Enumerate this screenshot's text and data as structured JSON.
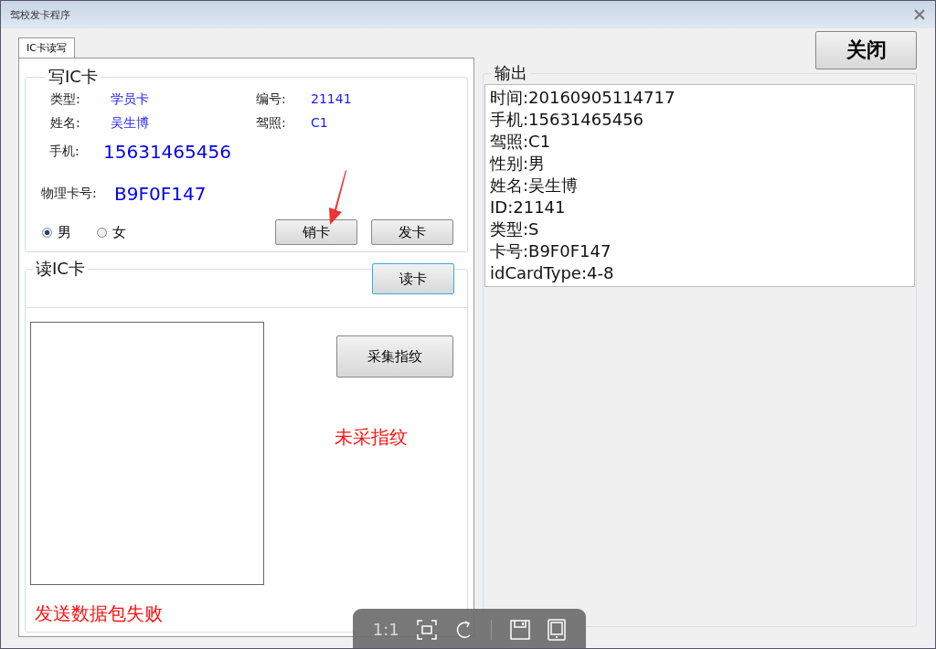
{
  "window": {
    "title": "驾校发卡程序"
  },
  "tabs": [
    {
      "label": "IC卡读写",
      "selected": true
    }
  ],
  "close_button": "关闭",
  "write_card": {
    "title": "写IC卡",
    "fields": [
      {
        "label": "类型:",
        "value": "学员卡"
      },
      {
        "label": "编号:",
        "value": "21141"
      },
      {
        "label": "姓名:",
        "value": "吴生博"
      },
      {
        "label": "驾照:",
        "value": "C1"
      }
    ],
    "phone": {
      "label": "手机:",
      "value": "15631465456"
    },
    "physical_card": {
      "label": "物理卡号:",
      "value": "B9F0F147"
    },
    "gender": [
      {
        "label": "男",
        "selected": true
      },
      {
        "label": "女",
        "selected": false
      }
    ],
    "buttons": [
      "销卡",
      "发卡"
    ]
  },
  "read_card": {
    "title": "读IC卡",
    "button": "读卡",
    "focused": true
  },
  "fingerprint": {
    "button": "采集指纹",
    "status": "未采指纹"
  },
  "message": "发送数据包失败",
  "output": {
    "title": "输出",
    "lines": [
      "时间:20160905114717",
      "手机:15631465456",
      "驾照:C1",
      "性别:男",
      "姓名:吴生博",
      "ID:21141",
      "类型:S",
      "卡号:B9F0F147",
      "idCardType:4-8"
    ]
  },
  "viewer_toolbar": {
    "zoom_label": "1:1"
  }
}
